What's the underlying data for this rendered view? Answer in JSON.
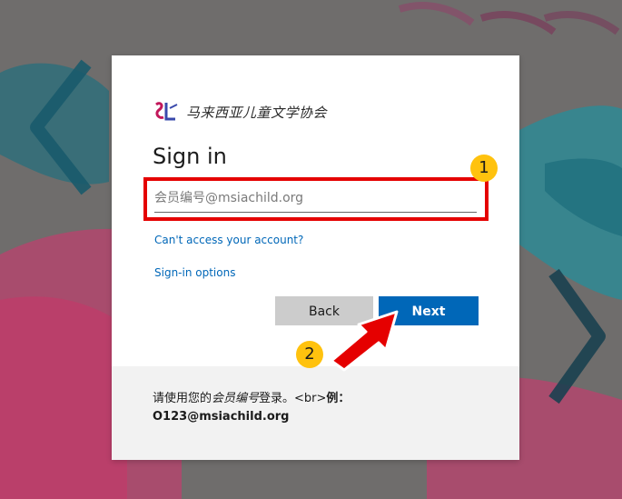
{
  "logo": {
    "text": "马来西亚儿童文学协会"
  },
  "signin": {
    "title": "Sign in",
    "input_placeholder": "会员编号@msiachild.org",
    "input_value": "",
    "cant_access": "Can't access your account?",
    "signin_options": "Sign-in options",
    "back_label": "Back",
    "next_label": "Next"
  },
  "footer": {
    "text_before": "请使用您的",
    "text_em": "会员编号",
    "text_after": "登录。<br>",
    "text_strong_label": "例：",
    "example": "O123@msiachild.org"
  },
  "annotations": {
    "badge1": "1",
    "badge2": "2"
  },
  "colors": {
    "accent": "#0067b8",
    "highlight": "#e50000",
    "badge": "#ffc20e"
  }
}
